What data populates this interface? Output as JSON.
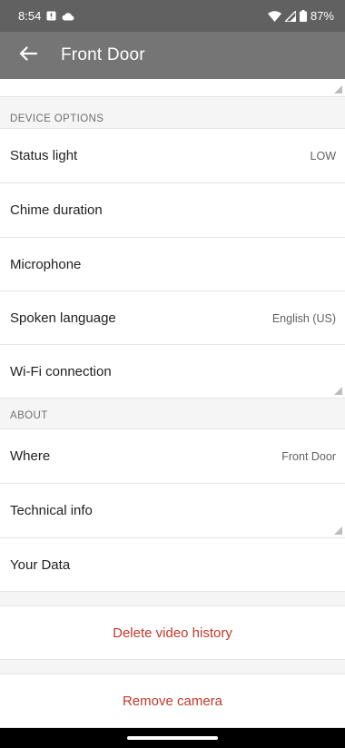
{
  "status_bar": {
    "time": "8:54",
    "battery": "87%",
    "icons": [
      "notification-badge-icon",
      "cloud-icon",
      "wifi-icon",
      "cellular-signal-icon",
      "battery-icon"
    ]
  },
  "app_bar": {
    "title": "Front Door",
    "back_icon": "arrow-left-icon"
  },
  "device_options": {
    "header": "DEVICE OPTIONS",
    "items": [
      {
        "label": "Status light",
        "value": "LOW"
      },
      {
        "label": "Chime duration",
        "value": ""
      },
      {
        "label": "Microphone",
        "value": ""
      },
      {
        "label": "Spoken language",
        "value": "English (US)"
      },
      {
        "label": "Wi-Fi connection",
        "value": ""
      }
    ]
  },
  "about": {
    "header": "ABOUT",
    "items": [
      {
        "label": "Where",
        "value": "Front Door"
      },
      {
        "label": "Technical info",
        "value": ""
      },
      {
        "label": "Your Data",
        "value": ""
      }
    ]
  },
  "actions": {
    "delete_history": "Delete video history",
    "remove_camera": "Remove camera"
  },
  "colors": {
    "status_bar": "#616161",
    "app_bar": "#757575",
    "destructive": "#c0392b",
    "background": "#f5f5f5"
  }
}
